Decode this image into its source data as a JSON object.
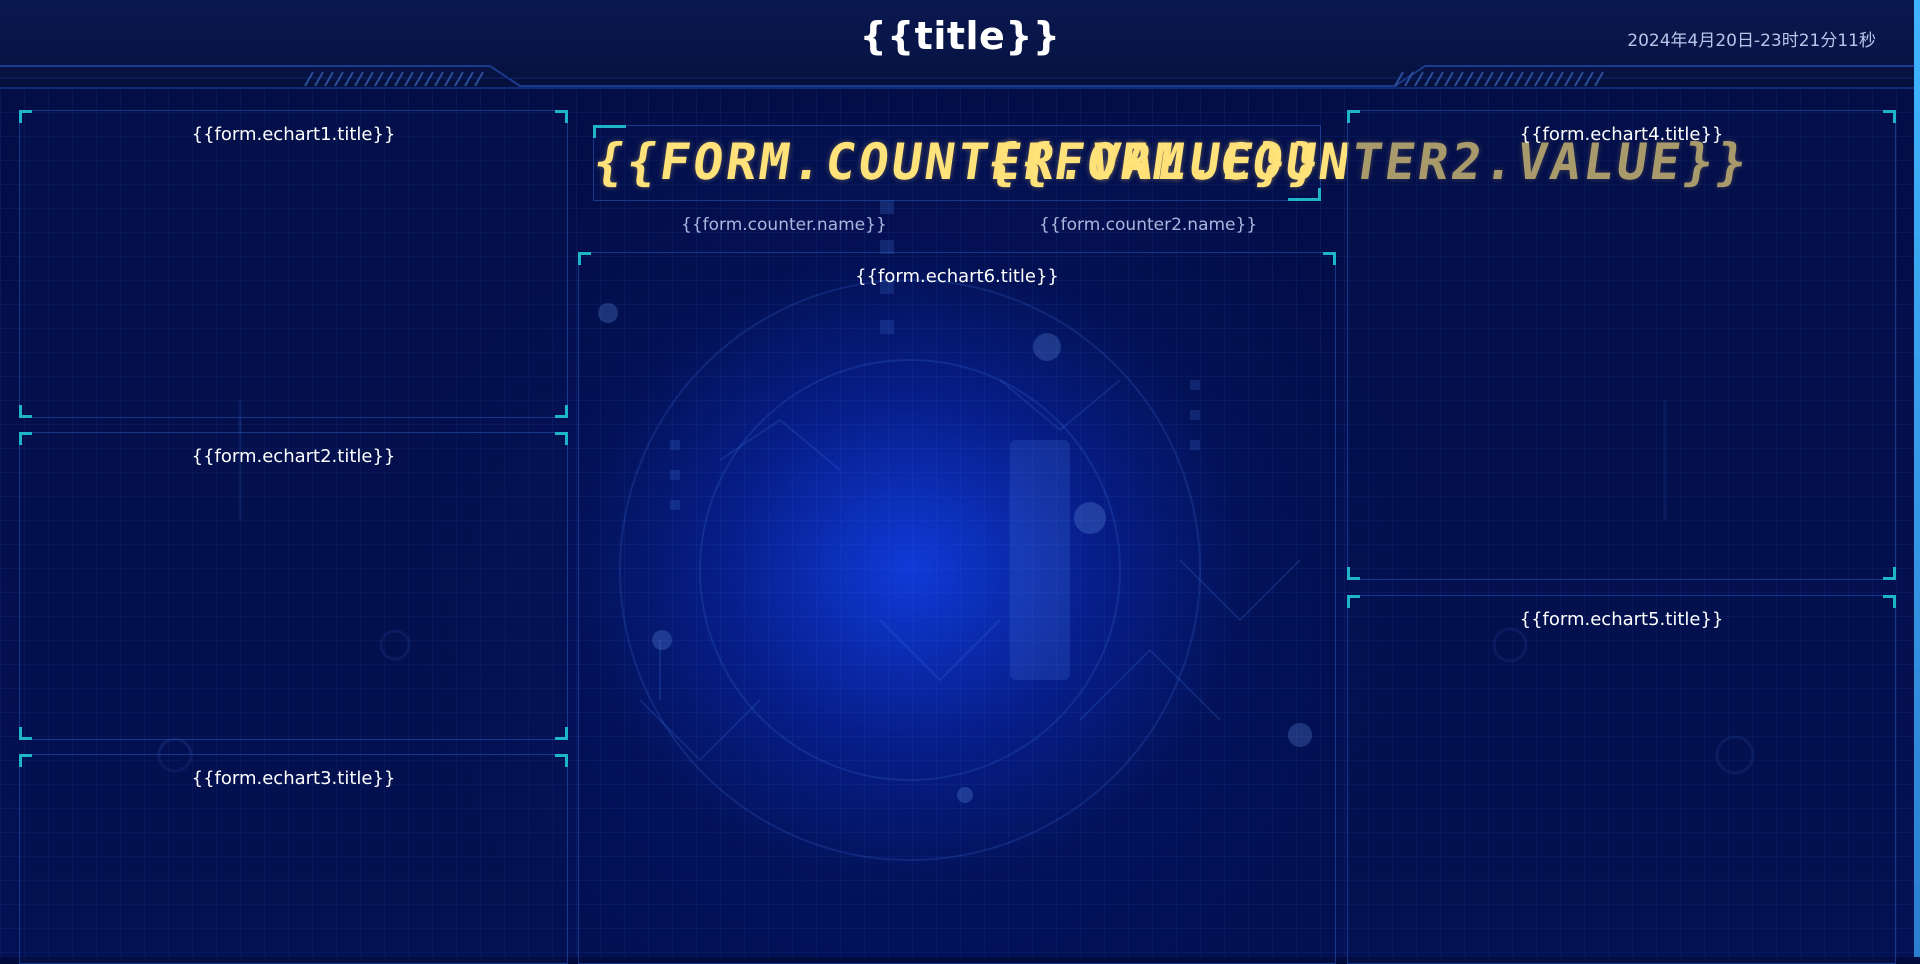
{
  "header": {
    "title": "{{title}}",
    "datetime": "2024年4月20日-23时21分11秒"
  },
  "panels": {
    "echart1": {
      "title": "{{form.echart1.title}}"
    },
    "echart2": {
      "title": "{{form.echart2.title}}"
    },
    "echart3": {
      "title": "{{form.echart3.title}}"
    },
    "echart4": {
      "title": "{{form.echart4.title}}"
    },
    "echart5": {
      "title": "{{form.echart5.title}}"
    },
    "echart6": {
      "title": "{{form.echart6.title}}"
    }
  },
  "counters": {
    "counter1": {
      "value": "{{FORM.COUNTER.VALUE}}",
      "name": "{{form.counter.name}}"
    },
    "counter2": {
      "value": "{{FORM.COUNTER2.VALUE}}",
      "name": "{{form.counter2.name}}"
    }
  },
  "colors": {
    "background": "#020b3e",
    "accent_corner": "#1fb5c9",
    "counter_text": "#ffe27a",
    "glow_center": "#1446ff"
  }
}
